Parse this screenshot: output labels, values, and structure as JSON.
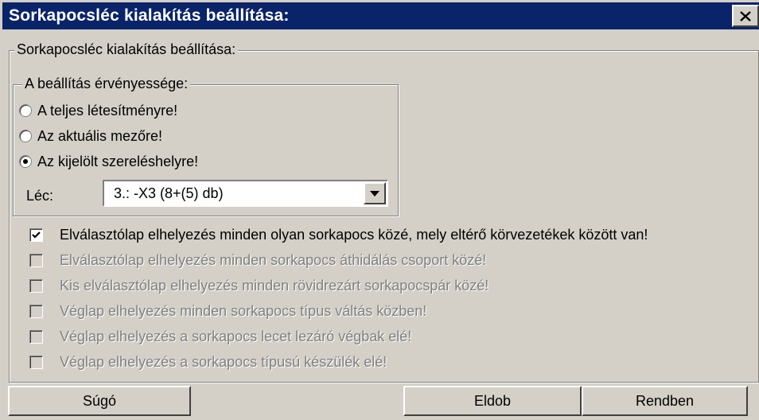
{
  "window": {
    "title": "Sorkapocsléc kialakítás beállítása:",
    "close_glyph": "✕"
  },
  "group_main": {
    "legend": "Sorkapocsléc kialakítás beállítása:"
  },
  "scope": {
    "legend": "A beállítás érvényessége:",
    "options": [
      {
        "label": "A teljes létesítményre!",
        "selected": false
      },
      {
        "label": "Az aktuális mezőre!",
        "selected": false
      },
      {
        "label": "Az kijelölt szereléshelyre!",
        "selected": true
      }
    ],
    "lec_label": "Léc:",
    "lec_value": "3.:  -X3 (8+(5) db)"
  },
  "checkboxes": [
    {
      "label": "Elválasztólap elhelyezés minden olyan sorkapocs közé, mely eltérő körvezetékek között van!",
      "checked": true,
      "enabled": true
    },
    {
      "label": "Elválasztólap elhelyezés minden sorkapocs áthidálás csoport közé!",
      "checked": false,
      "enabled": false
    },
    {
      "label": "Kis elválasztólap elhelyezés minden rövidrezárt sorkapocspár közé!",
      "checked": false,
      "enabled": false
    },
    {
      "label": "Véglap elhelyezés minden sorkapocs típus váltás közben!",
      "checked": false,
      "enabled": false
    },
    {
      "label": "Véglap elhelyezés a sorkapocs lecet lezáró végbak elé!",
      "checked": false,
      "enabled": false
    },
    {
      "label": "Véglap elhelyezés a sorkapocs típusú készülék elé!",
      "checked": false,
      "enabled": false
    }
  ],
  "buttons": {
    "help": "Súgó",
    "discard": "Eldob",
    "ok": "Rendben"
  }
}
